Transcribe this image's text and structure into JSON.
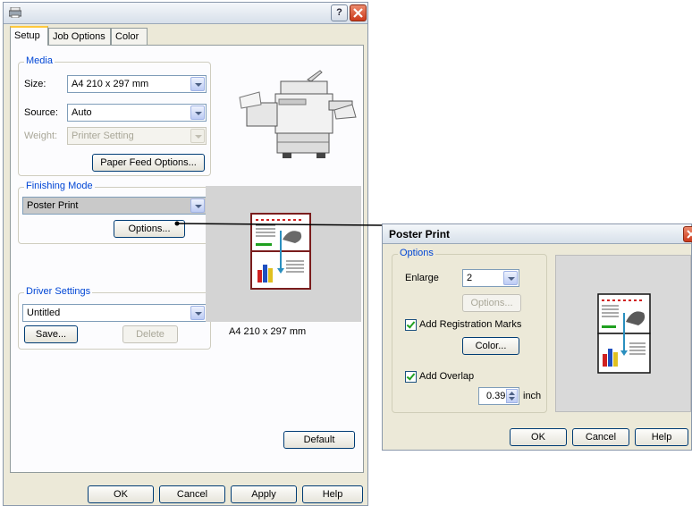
{
  "main_dialog": {
    "tabs": [
      "Setup",
      "Job Options",
      "Color"
    ],
    "media": {
      "group_label": "Media",
      "size_label": "Size:",
      "size_value": "A4 210 x 297 mm",
      "source_label": "Source:",
      "source_value": "Auto",
      "weight_label": "Weight:",
      "weight_value": "Printer Setting",
      "paper_feed_button": "Paper Feed Options..."
    },
    "finishing": {
      "group_label": "Finishing Mode",
      "mode_value": "Poster Print",
      "options_button": "Options..."
    },
    "driver_settings": {
      "group_label": "Driver Settings",
      "value": "Untitled",
      "save_button": "Save...",
      "delete_button": "Delete"
    },
    "preview_caption": "A4 210 x 297 mm",
    "default_button": "Default",
    "footer": {
      "ok": "OK",
      "cancel": "Cancel",
      "apply": "Apply",
      "help": "Help"
    },
    "help_icon": "?"
  },
  "poster_dialog": {
    "title": "Poster Print",
    "options_group": "Options",
    "enlarge_label": "Enlarge",
    "enlarge_value": "2",
    "options_button": "Options...",
    "add_registration_marks": "Add Registration Marks",
    "registration_checked": true,
    "color_button": "Color...",
    "add_overlap": "Add Overlap",
    "overlap_checked": true,
    "overlap_value": "0.39",
    "overlap_unit": "inch",
    "ok": "OK",
    "cancel": "Cancel",
    "help": "Help"
  },
  "colors": {
    "accent_blue": "#0046d5",
    "close_red": "#d9472b",
    "tab_highlight": "#ffc83c"
  }
}
